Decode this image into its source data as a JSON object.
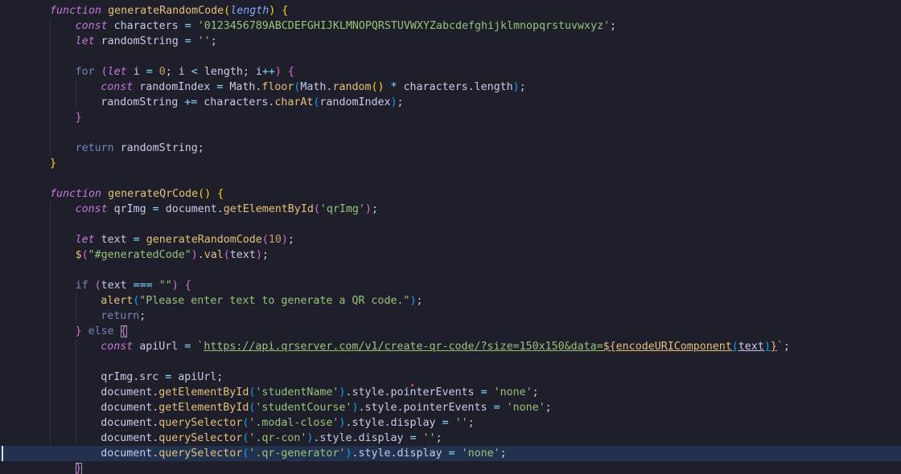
{
  "editor": {
    "colors": {
      "background": "#1e1f2b",
      "active_line": "#22314e",
      "keyword": "#c678dd",
      "function_name": "#e5c07b",
      "string": "#98c379",
      "number": "#d19a66",
      "param": "#8aa8ff",
      "operator": "#89ddff",
      "bracket": "#ffd700",
      "comment_flow": "#7a84b8"
    },
    "lines": [
      {
        "indent": 0,
        "tokens": [
          {
            "t": "function",
            "c": "kw_i"
          },
          {
            "t": " ",
            "c": "p"
          },
          {
            "t": "generateRandomCode",
            "c": "fn"
          },
          {
            "t": "(",
            "c": "br"
          },
          {
            "t": "length",
            "c": "param_i"
          },
          {
            "t": ")",
            "c": "br"
          },
          {
            "t": " ",
            "c": "p"
          },
          {
            "t": "{",
            "c": "br"
          }
        ]
      },
      {
        "indent": 1,
        "tokens": [
          {
            "t": "const",
            "c": "kw_i"
          },
          {
            "t": " characters ",
            "c": "var"
          },
          {
            "t": "=",
            "c": "op"
          },
          {
            "t": " ",
            "c": "p"
          },
          {
            "t": "'0123456789ABCDEFGHIJKLMNOPQRSTUVWXYZabcdefghijklmnopqrstuvwxyz'",
            "c": "str"
          },
          {
            "t": ";",
            "c": "p"
          }
        ]
      },
      {
        "indent": 1,
        "tokens": [
          {
            "t": "let",
            "c": "kw_i"
          },
          {
            "t": " randomString ",
            "c": "var"
          },
          {
            "t": "=",
            "c": "op"
          },
          {
            "t": " ",
            "c": "p"
          },
          {
            "t": "''",
            "c": "str"
          },
          {
            "t": ";",
            "c": "p"
          }
        ]
      },
      {
        "indent": 0,
        "tokens": []
      },
      {
        "indent": 1,
        "tokens": [
          {
            "t": "for",
            "c": "flow"
          },
          {
            "t": " ",
            "c": "p"
          },
          {
            "t": "(",
            "c": "br2"
          },
          {
            "t": "let",
            "c": "kw_i"
          },
          {
            "t": " i ",
            "c": "var"
          },
          {
            "t": "=",
            "c": "op"
          },
          {
            "t": " ",
            "c": "p"
          },
          {
            "t": "0",
            "c": "num"
          },
          {
            "t": "; i ",
            "c": "var"
          },
          {
            "t": "<",
            "c": "op"
          },
          {
            "t": " length; i",
            "c": "var"
          },
          {
            "t": "++",
            "c": "op"
          },
          {
            "t": ")",
            "c": "br2"
          },
          {
            "t": " ",
            "c": "p"
          },
          {
            "t": "{",
            "c": "br2"
          }
        ]
      },
      {
        "indent": 2,
        "tokens": [
          {
            "t": "const",
            "c": "kw_i"
          },
          {
            "t": " randomIndex ",
            "c": "var"
          },
          {
            "t": "=",
            "c": "op"
          },
          {
            "t": " Math.",
            "c": "var"
          },
          {
            "t": "floor",
            "c": "fn"
          },
          {
            "t": "(",
            "c": "br3"
          },
          {
            "t": "Math.",
            "c": "var"
          },
          {
            "t": "random",
            "c": "fn"
          },
          {
            "t": "()",
            "c": "br"
          },
          {
            "t": " ",
            "c": "p"
          },
          {
            "t": "*",
            "c": "op"
          },
          {
            "t": " characters.length",
            "c": "var"
          },
          {
            "t": ")",
            "c": "br3"
          },
          {
            "t": ";",
            "c": "p"
          }
        ]
      },
      {
        "indent": 2,
        "tokens": [
          {
            "t": "randomString ",
            "c": "var"
          },
          {
            "t": "+=",
            "c": "op"
          },
          {
            "t": " characters.",
            "c": "var"
          },
          {
            "t": "charAt",
            "c": "fn"
          },
          {
            "t": "(",
            "c": "br3"
          },
          {
            "t": "randomIndex",
            "c": "var"
          },
          {
            "t": ")",
            "c": "br3"
          },
          {
            "t": ";",
            "c": "p"
          }
        ]
      },
      {
        "indent": 1,
        "tokens": [
          {
            "t": "}",
            "c": "br2"
          }
        ]
      },
      {
        "indent": 0,
        "tokens": []
      },
      {
        "indent": 1,
        "tokens": [
          {
            "t": "return",
            "c": "flow"
          },
          {
            "t": " randomString;",
            "c": "var"
          }
        ]
      },
      {
        "indent": 0,
        "tokens": [
          {
            "t": "}",
            "c": "br"
          }
        ]
      },
      {
        "indent": 0,
        "tokens": []
      },
      {
        "indent": 0,
        "tokens": [
          {
            "t": "function",
            "c": "kw_i"
          },
          {
            "t": " ",
            "c": "p"
          },
          {
            "t": "generateQrCode",
            "c": "fn"
          },
          {
            "t": "()",
            "c": "br"
          },
          {
            "t": " ",
            "c": "p"
          },
          {
            "t": "{",
            "c": "br"
          }
        ]
      },
      {
        "indent": 1,
        "tokens": [
          {
            "t": "const",
            "c": "kw_i"
          },
          {
            "t": " qrImg ",
            "c": "var"
          },
          {
            "t": "=",
            "c": "op"
          },
          {
            "t": " document.",
            "c": "var"
          },
          {
            "t": "getElementById",
            "c": "fn"
          },
          {
            "t": "(",
            "c": "br2"
          },
          {
            "t": "'qrImg'",
            "c": "str"
          },
          {
            "t": ")",
            "c": "br2"
          },
          {
            "t": ";",
            "c": "p"
          }
        ]
      },
      {
        "indent": 0,
        "tokens": []
      },
      {
        "indent": 1,
        "tokens": [
          {
            "t": "let",
            "c": "kw_i"
          },
          {
            "t": " text ",
            "c": "var"
          },
          {
            "t": "=",
            "c": "op"
          },
          {
            "t": " ",
            "c": "p"
          },
          {
            "t": "generateRandomCode",
            "c": "fn"
          },
          {
            "t": "(",
            "c": "br2"
          },
          {
            "t": "10",
            "c": "num"
          },
          {
            "t": ")",
            "c": "br2"
          },
          {
            "t": ";",
            "c": "p"
          }
        ]
      },
      {
        "indent": 1,
        "tokens": [
          {
            "t": "$",
            "c": "fn"
          },
          {
            "t": "(",
            "c": "br2"
          },
          {
            "t": "\"#generatedCode\"",
            "c": "str"
          },
          {
            "t": ")",
            "c": "br2"
          },
          {
            "t": ".",
            "c": "var"
          },
          {
            "t": "val",
            "c": "fn"
          },
          {
            "t": "(",
            "c": "br2"
          },
          {
            "t": "text",
            "c": "var"
          },
          {
            "t": ")",
            "c": "br2"
          },
          {
            "t": ";",
            "c": "p"
          }
        ]
      },
      {
        "indent": 0,
        "tokens": []
      },
      {
        "indent": 1,
        "tokens": [
          {
            "t": "if",
            "c": "flow"
          },
          {
            "t": " ",
            "c": "p"
          },
          {
            "t": "(",
            "c": "br2"
          },
          {
            "t": "text ",
            "c": "var"
          },
          {
            "t": "===",
            "c": "op"
          },
          {
            "t": " ",
            "c": "p"
          },
          {
            "t": "\"\"",
            "c": "str"
          },
          {
            "t": ")",
            "c": "br2"
          },
          {
            "t": " ",
            "c": "p"
          },
          {
            "t": "{",
            "c": "br2"
          }
        ]
      },
      {
        "indent": 2,
        "tokens": [
          {
            "t": "alert",
            "c": "fn"
          },
          {
            "t": "(",
            "c": "br3"
          },
          {
            "t": "\"Please enter text to generate a QR code.\"",
            "c": "str"
          },
          {
            "t": ")",
            "c": "br3"
          },
          {
            "t": ";",
            "c": "p"
          }
        ]
      },
      {
        "indent": 2,
        "tokens": [
          {
            "t": "return",
            "c": "flow"
          },
          {
            "t": ";",
            "c": "p"
          }
        ]
      },
      {
        "indent": 1,
        "tokens": [
          {
            "t": "}",
            "c": "br2"
          },
          {
            "t": " ",
            "c": "p"
          },
          {
            "t": "else",
            "c": "flow"
          },
          {
            "t": " ",
            "c": "p"
          },
          {
            "t": "{",
            "c": "br2box"
          }
        ]
      },
      {
        "indent": 2,
        "tokens": [
          {
            "t": "const",
            "c": "kw_i"
          },
          {
            "t": " apiUrl ",
            "c": "var"
          },
          {
            "t": "=",
            "c": "op"
          },
          {
            "t": " ",
            "c": "p"
          },
          {
            "t": "`",
            "c": "str"
          },
          {
            "t": "https://api.qrserver.com/v1/create-qr-code/?size=150x150&data=",
            "c": "str_u"
          },
          {
            "t": "${",
            "c": "op_u"
          },
          {
            "t": "encodeURIComponent",
            "c": "fn_u"
          },
          {
            "t": "(",
            "c": "br3_u"
          },
          {
            "t": "text",
            "c": "var_u"
          },
          {
            "t": ")",
            "c": "br3_u"
          },
          {
            "t": "}",
            "c": "op_u"
          },
          {
            "t": "`",
            "c": "str"
          },
          {
            "t": ";",
            "c": "p"
          }
        ]
      },
      {
        "indent": 0,
        "tokens": []
      },
      {
        "indent": 2,
        "tokens": [
          {
            "t": "qrImg.src ",
            "c": "var"
          },
          {
            "t": "=",
            "c": "op"
          },
          {
            "t": " apiUrl;",
            "c": "var"
          }
        ]
      },
      {
        "indent": 2,
        "tokens": [
          {
            "t": "document.",
            "c": "var"
          },
          {
            "t": "getElementById",
            "c": "fn"
          },
          {
            "t": "(",
            "c": "br3"
          },
          {
            "t": "'studentName'",
            "c": "str"
          },
          {
            "t": ")",
            "c": "br3"
          },
          {
            "t": ".style.pointerEvents ",
            "c": "var"
          },
          {
            "t": "=",
            "c": "op"
          },
          {
            "t": " ",
            "c": "p"
          },
          {
            "t": "'none'",
            "c": "str"
          },
          {
            "t": ";",
            "c": "p"
          }
        ]
      },
      {
        "indent": 2,
        "tokens": [
          {
            "t": "document.",
            "c": "var"
          },
          {
            "t": "getElementById",
            "c": "fn"
          },
          {
            "t": "(",
            "c": "br3"
          },
          {
            "t": "'studentCourse'",
            "c": "str"
          },
          {
            "t": ")",
            "c": "br3"
          },
          {
            "t": ".style.pointerEvents ",
            "c": "var"
          },
          {
            "t": "=",
            "c": "op"
          },
          {
            "t": " ",
            "c": "p"
          },
          {
            "t": "'none'",
            "c": "str"
          },
          {
            "t": ";",
            "c": "p"
          }
        ]
      },
      {
        "indent": 2,
        "tokens": [
          {
            "t": "document.",
            "c": "var"
          },
          {
            "t": "querySelector",
            "c": "fn"
          },
          {
            "t": "(",
            "c": "br3"
          },
          {
            "t": "'.modal-close'",
            "c": "str"
          },
          {
            "t": ")",
            "c": "br3"
          },
          {
            "t": ".style.display ",
            "c": "var"
          },
          {
            "t": "=",
            "c": "op"
          },
          {
            "t": " ",
            "c": "p"
          },
          {
            "t": "''",
            "c": "str"
          },
          {
            "t": ";",
            "c": "p"
          }
        ]
      },
      {
        "indent": 2,
        "tokens": [
          {
            "t": "document.",
            "c": "var"
          },
          {
            "t": "querySelector",
            "c": "fn"
          },
          {
            "t": "(",
            "c": "br3"
          },
          {
            "t": "'.qr-con'",
            "c": "str"
          },
          {
            "t": ")",
            "c": "br3"
          },
          {
            "t": ".style.display ",
            "c": "var"
          },
          {
            "t": "=",
            "c": "op"
          },
          {
            "t": " ",
            "c": "p"
          },
          {
            "t": "''",
            "c": "str"
          },
          {
            "t": ";",
            "c": "p"
          }
        ]
      },
      {
        "indent": 2,
        "active": true,
        "tokens": [
          {
            "t": "document.",
            "c": "var"
          },
          {
            "t": "querySelector",
            "c": "fn"
          },
          {
            "t": "(",
            "c": "br3"
          },
          {
            "t": "'.qr-generator'",
            "c": "str"
          },
          {
            "t": ")",
            "c": "br3"
          },
          {
            "t": ".style.display ",
            "c": "var"
          },
          {
            "t": "=",
            "c": "op"
          },
          {
            "t": " ",
            "c": "p"
          },
          {
            "t": "'none'",
            "c": "str"
          },
          {
            "t": ";",
            "c": "p"
          }
        ]
      },
      {
        "indent": 1,
        "tokens": [
          {
            "t": "}",
            "c": "br2box"
          }
        ]
      }
    ]
  }
}
